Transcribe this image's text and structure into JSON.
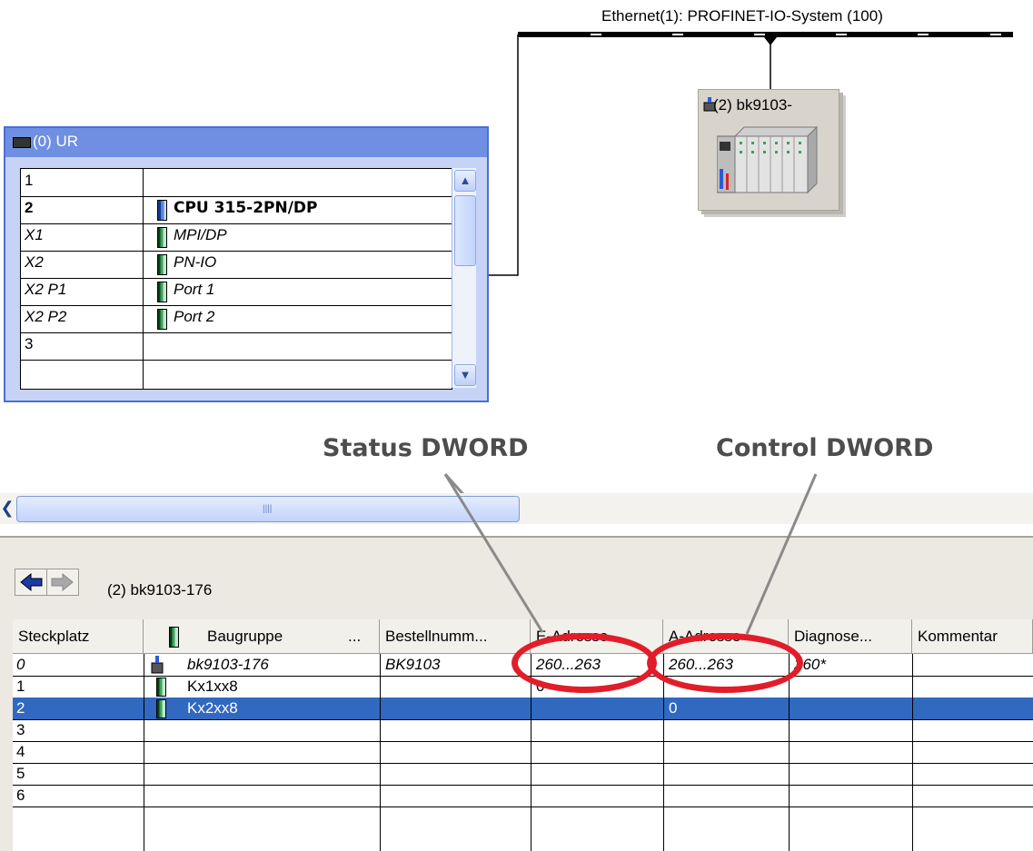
{
  "network": {
    "label": "Ethernet(1): PROFINET-IO-System (100)"
  },
  "device": {
    "title": "(2) bk9103-"
  },
  "rack": {
    "title": "(0) UR",
    "rows": [
      {
        "slot": "1",
        "module": "",
        "style": "normal"
      },
      {
        "slot": "2",
        "module": "CPU 315-2PN/DP",
        "style": "bold"
      },
      {
        "slot": "X1",
        "module": "MPI/DP",
        "style": "italic"
      },
      {
        "slot": "X2",
        "module": "PN-IO",
        "style": "italic"
      },
      {
        "slot": "X2 P1",
        "module": "Port 1",
        "style": "italic"
      },
      {
        "slot": "X2 P2",
        "module": "Port 2",
        "style": "italic"
      },
      {
        "slot": "3",
        "module": "",
        "style": "normal"
      }
    ]
  },
  "annotations": {
    "status": "Status DWORD",
    "control": "Control DWORD"
  },
  "detail": {
    "station": "(2)   bk9103-176",
    "columns": [
      "Steckplatz",
      "Baugruppe",
      "...",
      "Bestellnumm...",
      "E-Adresse",
      "A-Adresse",
      "Diagnose...",
      "Kommentar"
    ],
    "rows": [
      {
        "slot": "0",
        "module": "bk9103-176",
        "order": "BK9103",
        "e_addr": "260...263",
        "a_addr": "260...263",
        "diag": "260*",
        "comment": "",
        "italic": true,
        "selected": false
      },
      {
        "slot": "1",
        "module": "Kx1xx8",
        "order": "",
        "e_addr": "0",
        "a_addr": "",
        "diag": "",
        "comment": "",
        "italic": false,
        "selected": false
      },
      {
        "slot": "2",
        "module": "Kx2xx8",
        "order": "",
        "e_addr": "",
        "a_addr": "0",
        "diag": "",
        "comment": "",
        "italic": false,
        "selected": true
      },
      {
        "slot": "3",
        "module": "",
        "order": "",
        "e_addr": "",
        "a_addr": "",
        "diag": "",
        "comment": "",
        "italic": false,
        "selected": false
      },
      {
        "slot": "4",
        "module": "",
        "order": "",
        "e_addr": "",
        "a_addr": "",
        "diag": "",
        "comment": "",
        "italic": false,
        "selected": false
      },
      {
        "slot": "5",
        "module": "",
        "order": "",
        "e_addr": "",
        "a_addr": "",
        "diag": "",
        "comment": "",
        "italic": false,
        "selected": false
      },
      {
        "slot": "6",
        "module": "",
        "order": "",
        "e_addr": "",
        "a_addr": "",
        "diag": "",
        "comment": "",
        "italic": false,
        "selected": false
      }
    ]
  },
  "colors": {
    "rack_frame": "#4a6fd6",
    "selection": "#3168c0",
    "highlight_ring": "#e21d2a",
    "annotation_text": "#4d4d4d"
  }
}
